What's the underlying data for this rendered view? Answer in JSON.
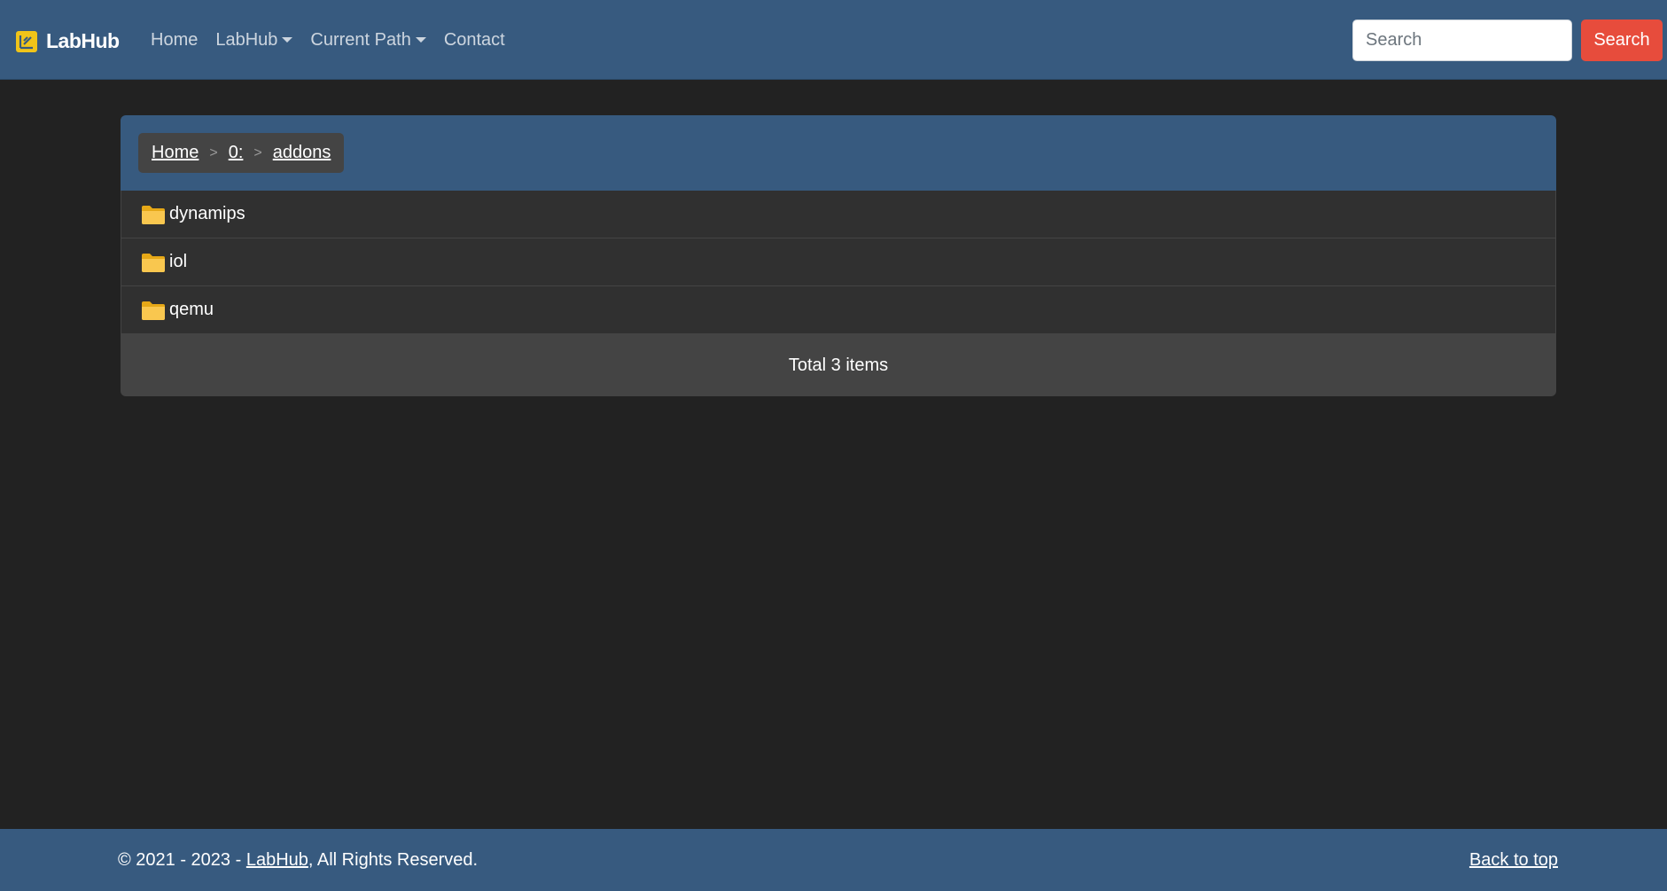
{
  "navbar": {
    "brand": "LabHub",
    "brand_icon": "labhub-logo-icon",
    "links": [
      {
        "label": "Home",
        "dropdown": false
      },
      {
        "label": "LabHub",
        "dropdown": true
      },
      {
        "label": "Current Path",
        "dropdown": true
      },
      {
        "label": "Contact",
        "dropdown": false
      }
    ],
    "search_placeholder": "Search",
    "search_button": "Search"
  },
  "breadcrumb": {
    "items": [
      "Home",
      "0:",
      "addons"
    ],
    "separator": ">"
  },
  "files": [
    {
      "name": "dynamips",
      "icon": "folder-icon"
    },
    {
      "name": "iol",
      "icon": "folder-icon"
    },
    {
      "name": "qemu",
      "icon": "folder-icon"
    }
  ],
  "summary": "Total 3 items",
  "footer": {
    "copyright_prefix": "© 2021 - 2023 - ",
    "copyright_link": "LabHub",
    "copyright_suffix": ", All Rights Reserved.",
    "back_to_top": "Back to top"
  },
  "colors": {
    "primary": "#375a7f",
    "danger": "#e74c3c",
    "background": "#222222",
    "folder": "#f9c74f"
  }
}
